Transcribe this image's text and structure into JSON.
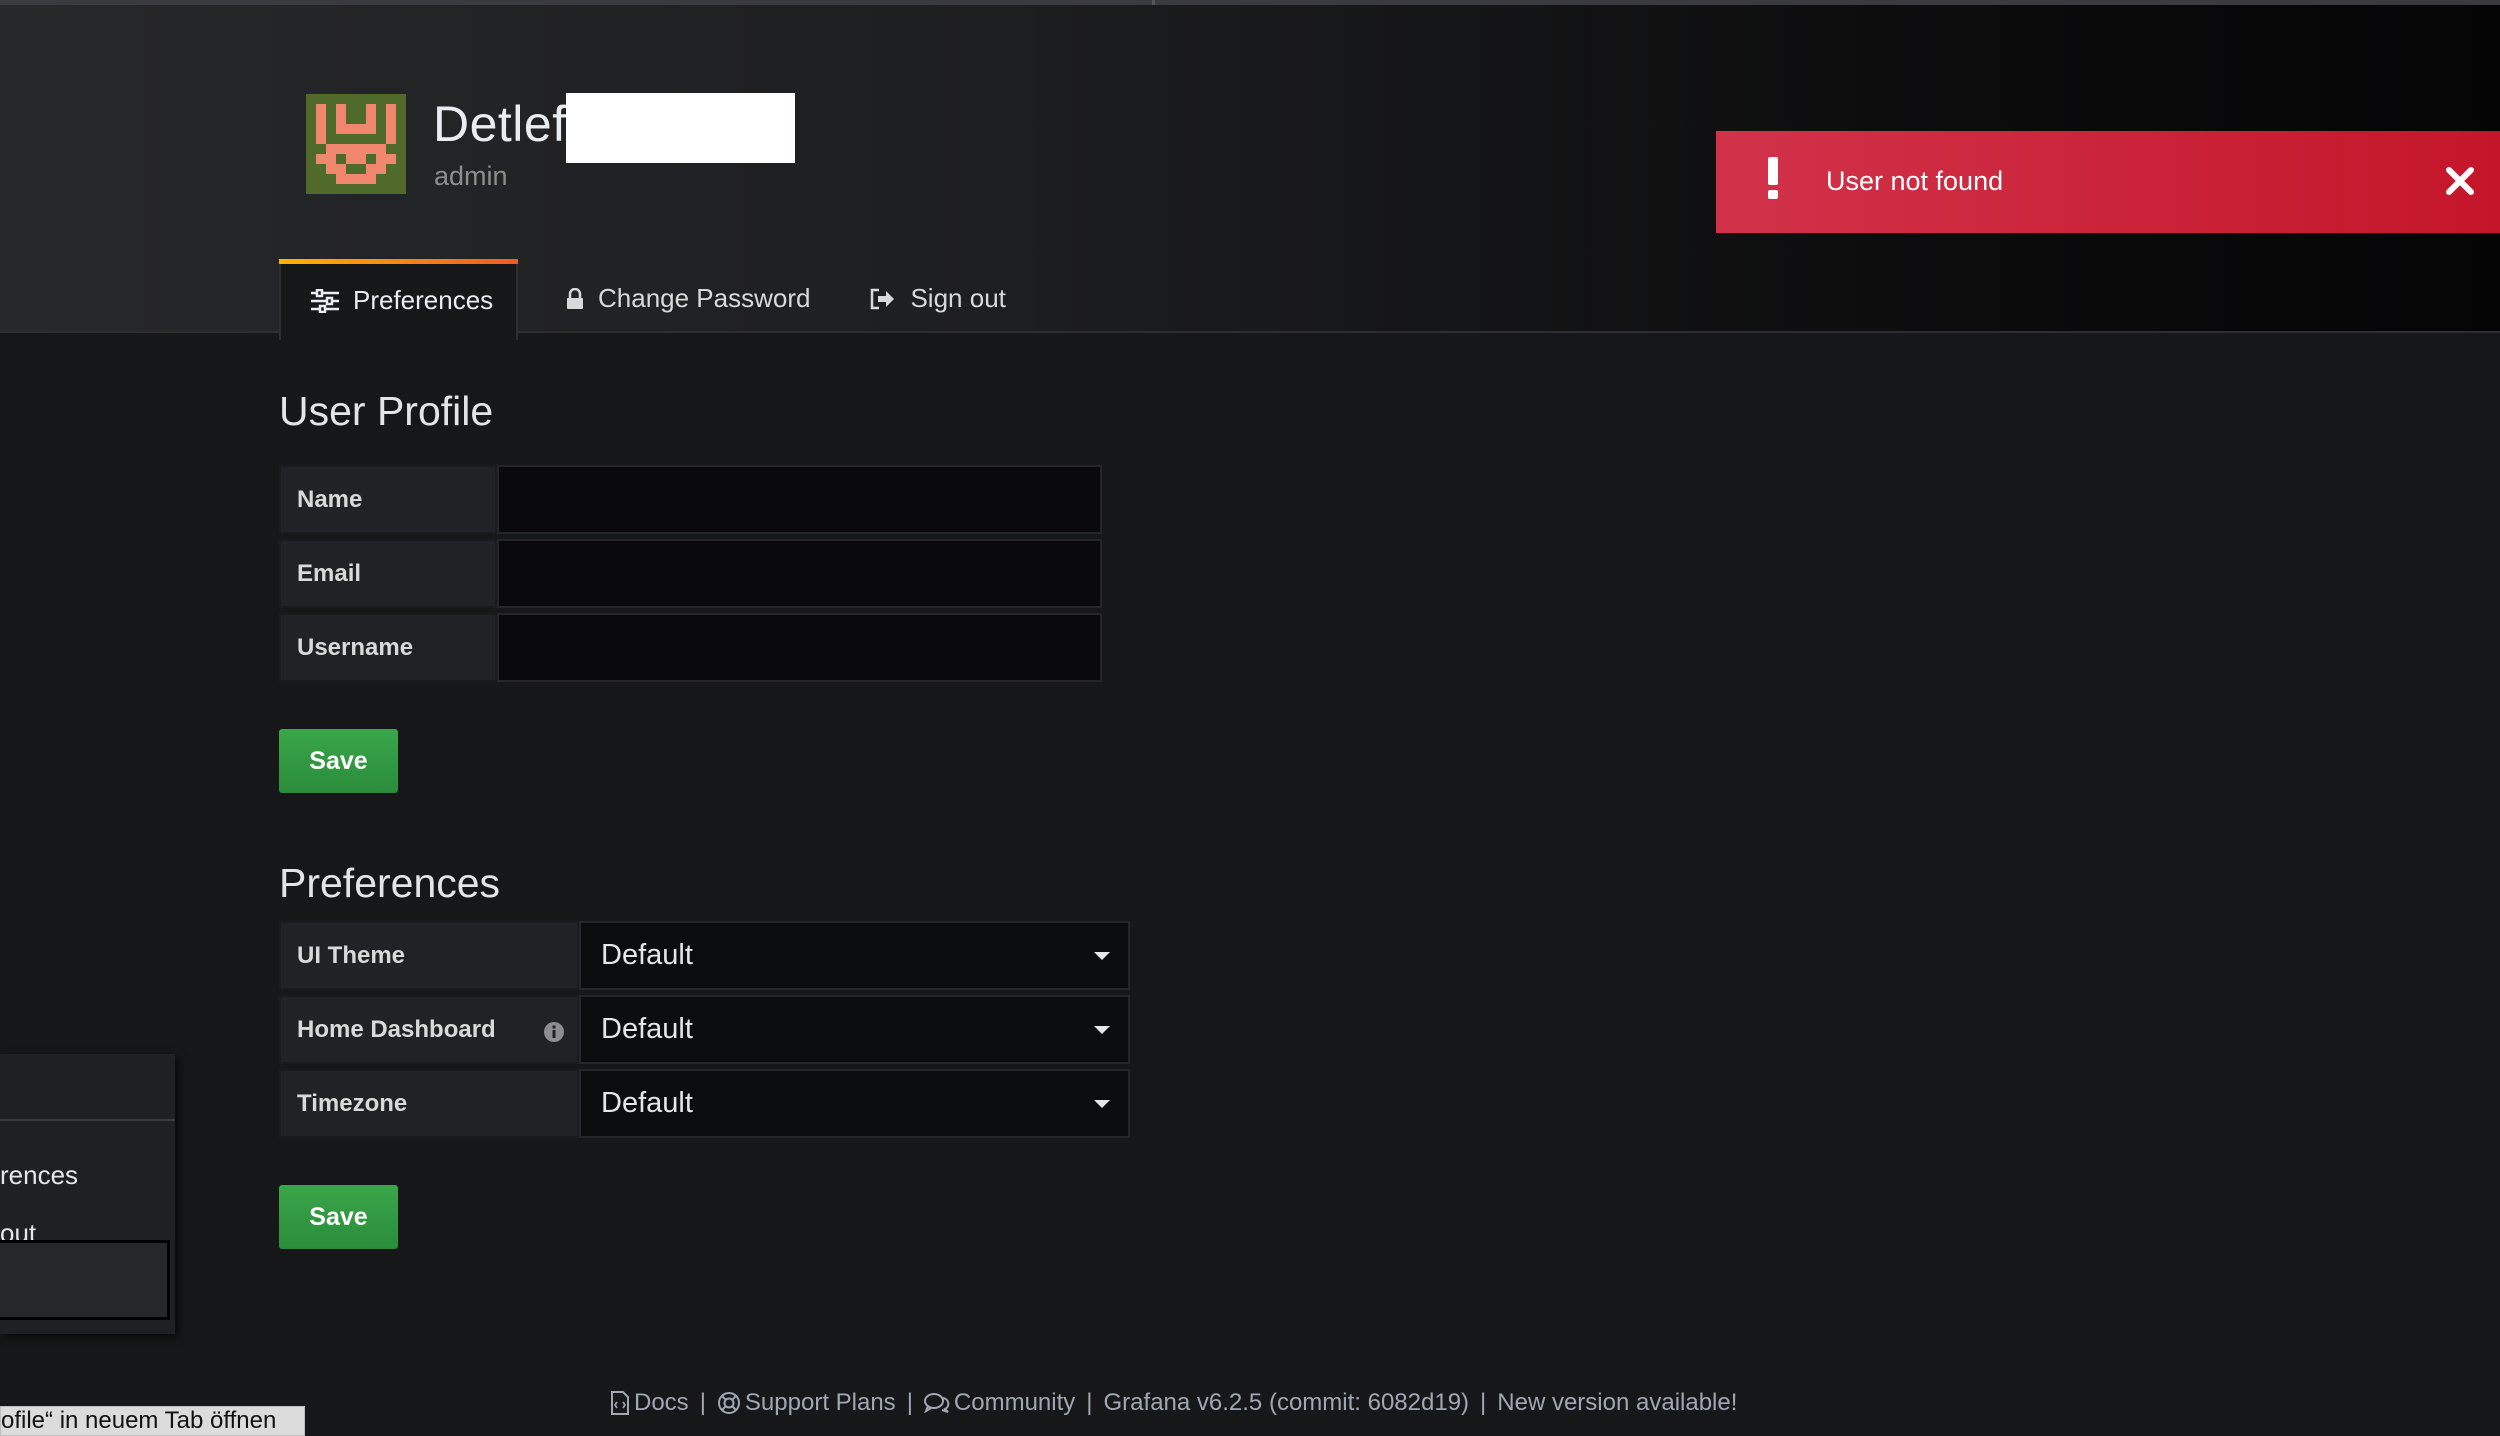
{
  "user": {
    "name": "Detlef",
    "role": "admin"
  },
  "tabs": [
    {
      "label": "Preferences",
      "icon": "sliders-icon"
    },
    {
      "label": "Change Password",
      "icon": "lock-icon"
    },
    {
      "label": "Sign out",
      "icon": "sign-out-icon"
    }
  ],
  "alert": {
    "message": "User not found",
    "icon": "exclamation-icon",
    "close_icon": "close-icon"
  },
  "profile": {
    "title": "User Profile",
    "fields": [
      {
        "label": "Name",
        "value": ""
      },
      {
        "label": "Email",
        "value": ""
      },
      {
        "label": "Username",
        "value": ""
      }
    ],
    "save_label": "Save"
  },
  "preferences": {
    "title": "Preferences",
    "fields": [
      {
        "label": "UI Theme",
        "value": "Default"
      },
      {
        "label": "Home Dashboard",
        "value": "Default"
      },
      {
        "label": "Timezone",
        "value": "Default"
      }
    ],
    "save_label": "Save"
  },
  "side_menu": {
    "items": [
      "rences",
      "out"
    ]
  },
  "footer": {
    "docs": "Docs",
    "support": "Support Plans",
    "community": "Community",
    "version": "Grafana v6.2.5 (commit: 6082d19)",
    "update": "New version available!",
    "separator": "|"
  },
  "tooltip": {
    "text": "ofile“ in neuem Tab öffnen"
  },
  "colors": {
    "alert": "#d1324a",
    "save_button": "#3aa64a",
    "tab_accent": "#f05a28"
  }
}
